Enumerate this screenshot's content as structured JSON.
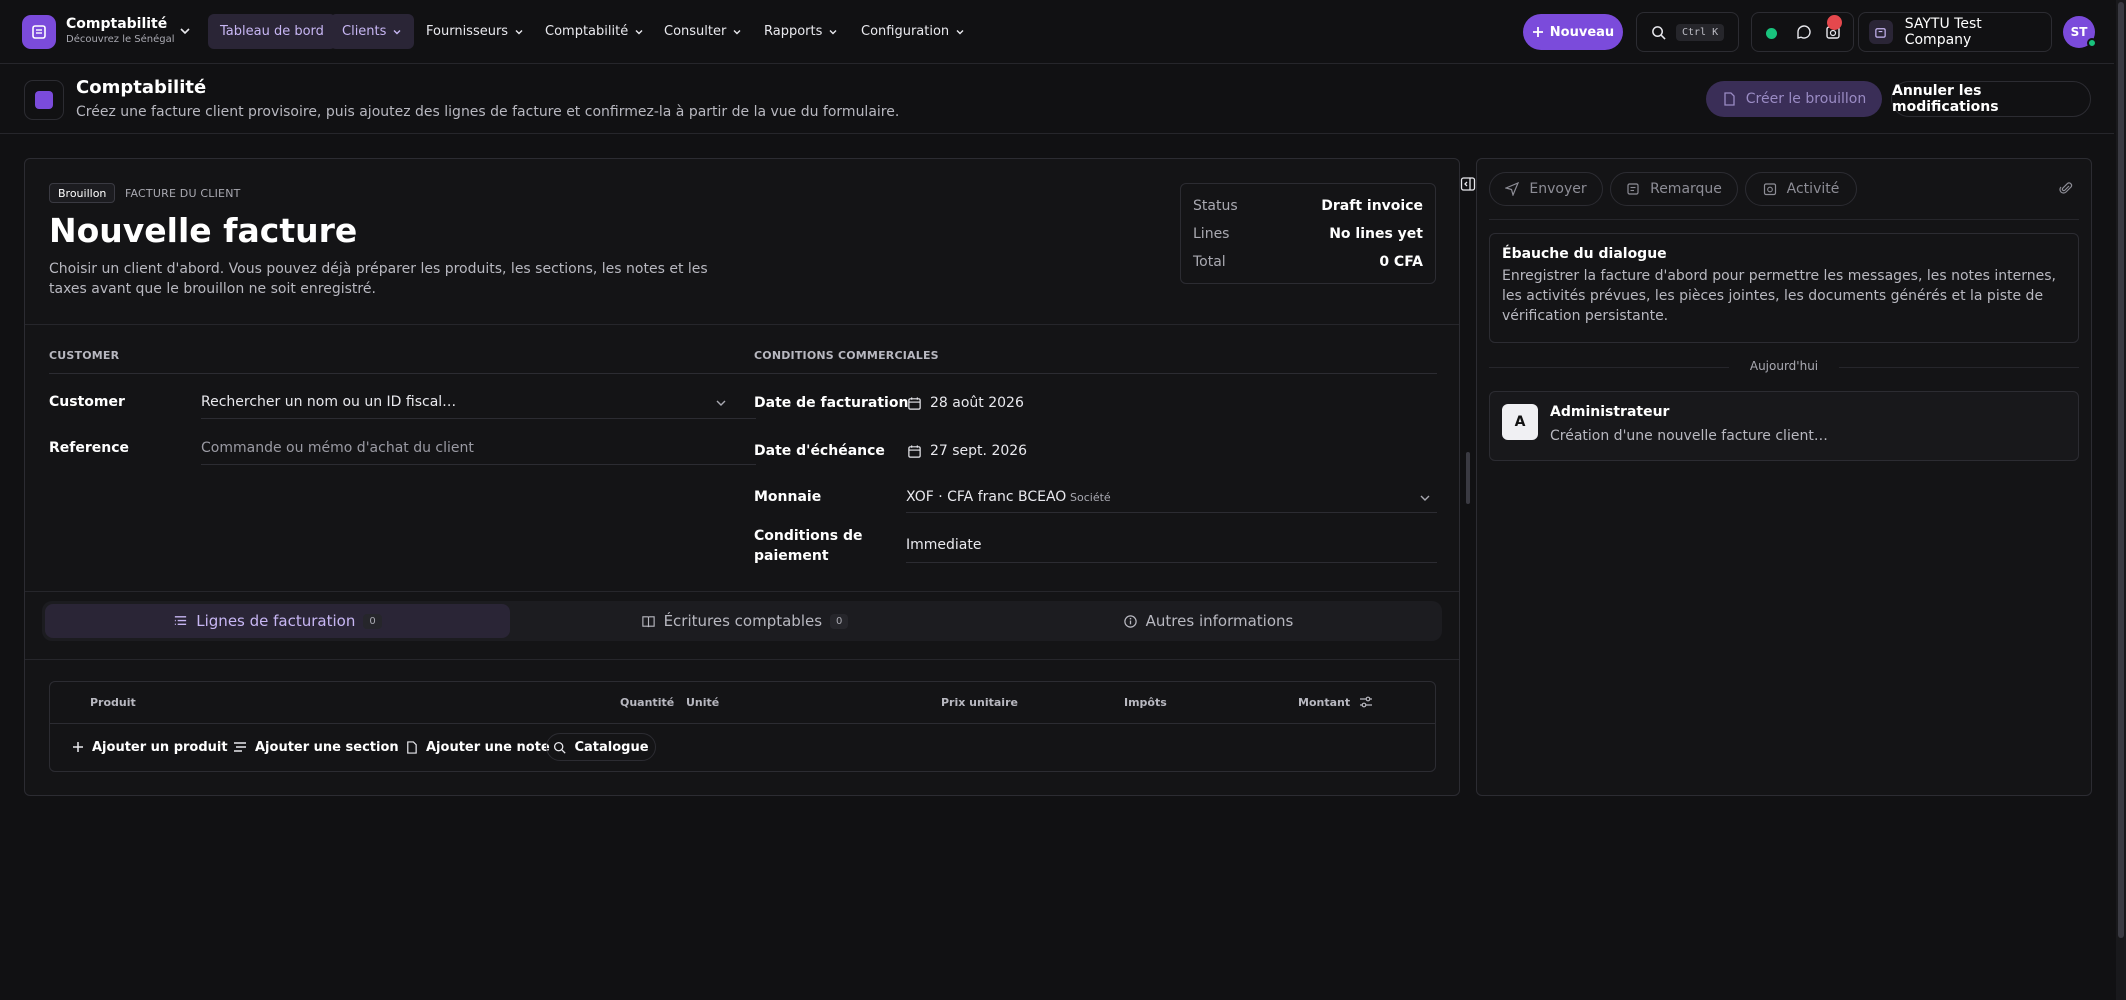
{
  "app": {
    "name": "Comptabilité",
    "subtitle": "Découvrez le Sénégal"
  },
  "nav": {
    "items": [
      {
        "label": "Tableau de bord"
      },
      {
        "label": "Clients"
      },
      {
        "label": "Fournisseurs"
      },
      {
        "label": "Comptabilité"
      },
      {
        "label": "Consulter"
      },
      {
        "label": "Rapports"
      },
      {
        "label": "Configuration"
      }
    ],
    "new_button": "Nouveau",
    "search_shortcut": "Ctrl K",
    "company": "SAYTU Test Company",
    "user_initials": "ST"
  },
  "page_header": {
    "title": "Comptabilité",
    "subtitle": "Créez une facture client provisoire, puis ajoutez des lignes de facture et confirmez-la à partir de la vue du formulaire.",
    "create_draft_button": "Créer le brouillon",
    "cancel_button": "Annuler les modifications"
  },
  "invoice": {
    "status_chip": "Brouillon",
    "doc_type": "FACTURE DU CLIENT",
    "title": "Nouvelle facture",
    "description": "Choisir un client d'abord. Vous pouvez déjà préparer les produits, les sections, les notes et les taxes avant que le brouillon ne soit enregistré.",
    "summary": {
      "status_label": "Status",
      "status_value": "Draft invoice",
      "lines_label": "Lines",
      "lines_value": "No lines yet",
      "total_label": "Total",
      "total_value": "0 CFA"
    },
    "customer_section": {
      "title": "CUSTOMER",
      "customer_label": "Customer",
      "customer_placeholder": "Rechercher un nom ou un ID fiscal…",
      "reference_label": "Reference",
      "reference_placeholder": "Commande ou mémo d'achat du client"
    },
    "terms_section": {
      "title": "CONDITIONS COMMERCIALES",
      "invoice_date_label": "Date de facturation",
      "invoice_date_value": "28 août 2026",
      "due_date_label": "Date d'échéance",
      "due_date_value": "27 sept. 2026",
      "currency_label": "Monnaie",
      "currency_value": "XOF · CFA franc BCEAO",
      "currency_tag": "Société",
      "payment_terms_label": "Conditions de paiement",
      "payment_terms_value": "Immediate"
    },
    "tabs": [
      {
        "label": "Lignes de facturation",
        "count": "0"
      },
      {
        "label": "Écritures comptables",
        "count": "0"
      },
      {
        "label": "Autres informations"
      }
    ],
    "table": {
      "columns": [
        "Produit",
        "Quantité",
        "Unité",
        "Prix unitaire",
        "Impôts",
        "Montant"
      ],
      "actions": {
        "add_product": "Ajouter un produit",
        "add_section": "Ajouter une section",
        "add_note": "Ajouter une note",
        "catalog": "Catalogue"
      }
    }
  },
  "chatter": {
    "tabs": [
      {
        "label": "Envoyer"
      },
      {
        "label": "Remarque"
      },
      {
        "label": "Activité"
      }
    ],
    "draft_dialog_title": "Ébauche du dialogue",
    "draft_dialog_text": "Enregistrer la facture d'abord pour permettre les messages, les notes internes, les activités prévues, les pièces jointes, les documents générés et la piste de vérification persistante.",
    "today_label": "Aujourd'hui",
    "activity": {
      "avatar_letter": "A",
      "author": "Administrateur",
      "text": "Création d'une nouvelle facture client…"
    }
  },
  "colors": {
    "accent": "#7b4bdb",
    "background": "#111113",
    "online": "#19c37d",
    "notification": "#e5484d"
  }
}
